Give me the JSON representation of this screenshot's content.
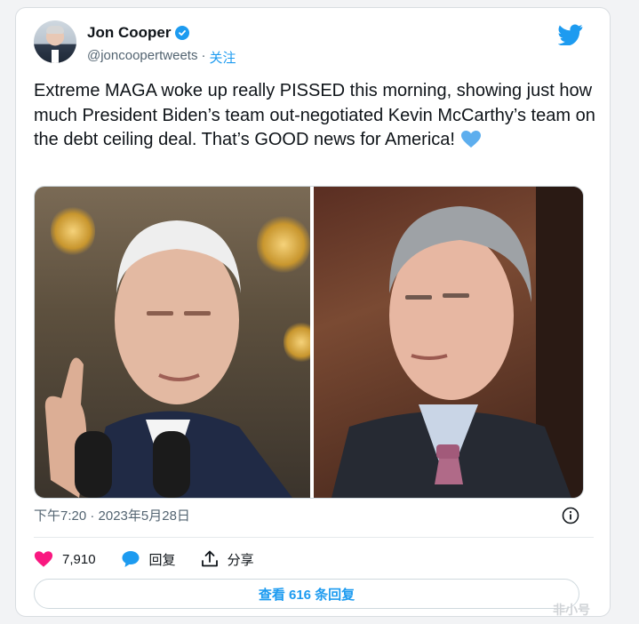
{
  "author": {
    "name": "Jon Cooper",
    "handle": "@joncoopertweets",
    "separator": "·",
    "follow_label": "关注"
  },
  "tweet": {
    "text": "Extreme MAGA woke up really PISSED this morning, showing just how much President Biden’s team out-negotiated Kevin McCarthy’s team on the debt ceiling deal. That’s GOOD news for America!",
    "emoji": "blue-heart"
  },
  "timestamp": "下午7:20 · 2023年5月28日",
  "actions": {
    "likes_count": "7,910",
    "reply_label": "回复",
    "share_label": "分享"
  },
  "view_replies_label": "查看 616 条回复",
  "watermark": "非小号",
  "colors": {
    "accent": "#1d9bf0",
    "like": "#f91880",
    "text": "#0f1419",
    "secondary": "#536471"
  }
}
